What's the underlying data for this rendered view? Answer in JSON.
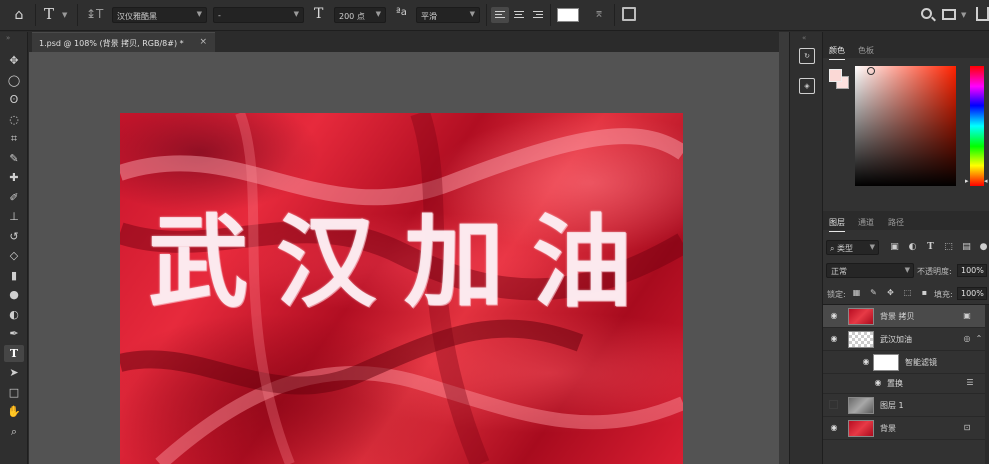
{
  "options_bar": {
    "tool_glyph": "T",
    "font_family": "汉仪雅酷黑",
    "font_style": "-",
    "font_size": "200 点",
    "aa_label": "ªa",
    "antialias": "平滑",
    "text_color": "#ffffff"
  },
  "document_tab": {
    "title": "1.psd @ 108% (背景 拷贝, RGB/8#) *",
    "close": "×"
  },
  "canvas": {
    "text_chars": [
      "武",
      "汉",
      "加",
      "油"
    ],
    "fabric_color": "#d41a2e"
  },
  "toolbar": {
    "tools": [
      {
        "name": "move-tool",
        "glyph": "✥"
      },
      {
        "name": "marquee-tool",
        "glyph": "◯"
      },
      {
        "name": "lasso-tool",
        "glyph": "ʘ"
      },
      {
        "name": "quick-select-tool",
        "glyph": "◌"
      },
      {
        "name": "crop-tool",
        "glyph": "⌗"
      },
      {
        "name": "eyedropper-tool",
        "glyph": "✎"
      },
      {
        "name": "healing-tool",
        "glyph": "✚"
      },
      {
        "name": "brush-tool",
        "glyph": "✐"
      },
      {
        "name": "stamp-tool",
        "glyph": "⊥"
      },
      {
        "name": "history-brush-tool",
        "glyph": "↺"
      },
      {
        "name": "eraser-tool",
        "glyph": "◇"
      },
      {
        "name": "gradient-tool",
        "glyph": "▮"
      },
      {
        "name": "blur-tool",
        "glyph": "●"
      },
      {
        "name": "dodge-tool",
        "glyph": "◐"
      },
      {
        "name": "pen-tool",
        "glyph": "✒"
      },
      {
        "name": "type-tool",
        "glyph": "T"
      },
      {
        "name": "path-select-tool",
        "glyph": "➤"
      },
      {
        "name": "shape-tool",
        "glyph": "□"
      },
      {
        "name": "hand-tool",
        "glyph": "✋"
      },
      {
        "name": "zoom-tool",
        "glyph": "⌕"
      }
    ]
  },
  "color_panel": {
    "tabs": [
      "颜色",
      "色板"
    ],
    "foreground": "#fbd9d6",
    "background": "#fde2e0"
  },
  "layers_panel": {
    "tabs": [
      "图层",
      "通道",
      "路径"
    ],
    "kind_filter": "类型",
    "blend_mode": "正常",
    "opacity_label": "不透明度:",
    "opacity": "100%",
    "lock_label": "锁定:",
    "fill_label": "填充:",
    "fill": "100%",
    "layers": [
      {
        "name": "背景 拷贝",
        "visible": true,
        "selected": true
      },
      {
        "name": "武汉加油",
        "visible": true,
        "selected": false
      },
      {
        "name": "智能滤镜",
        "visible": true,
        "selected": false
      },
      {
        "name": "置换",
        "visible": true,
        "selected": false
      },
      {
        "name": "图层 1",
        "visible": false,
        "selected": false
      },
      {
        "name": "背景",
        "visible": true,
        "selected": false
      }
    ]
  }
}
